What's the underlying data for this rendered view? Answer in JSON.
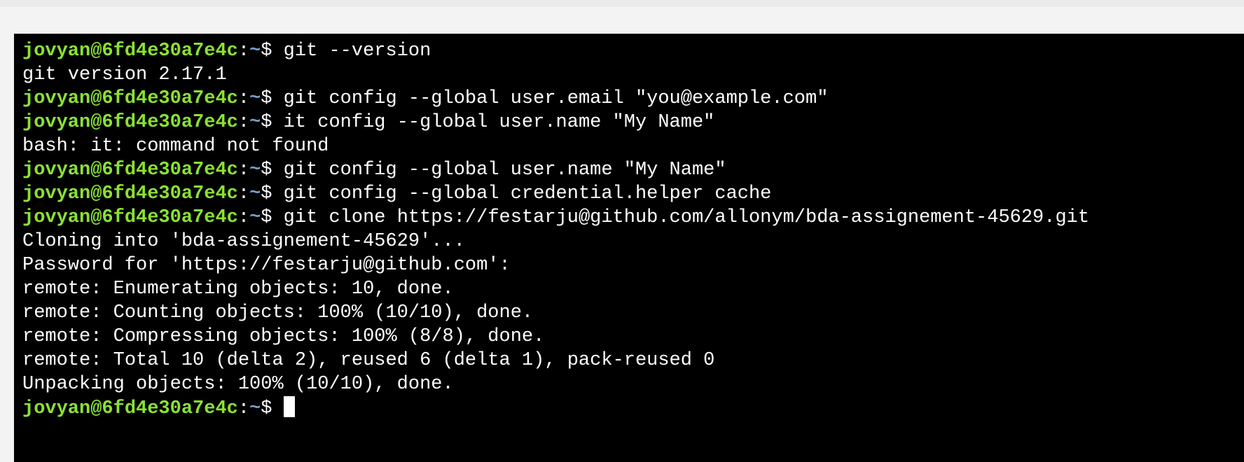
{
  "terminal": {
    "prompt_user_host": "jovyan@6fd4e30a7e4c",
    "prompt_path": "~",
    "prompt_symbol": "$ ",
    "colors": {
      "background": "#000000",
      "prompt_host": "#8ae234",
      "prompt_path": "#729fcf",
      "text": "#ffffff"
    },
    "lines": [
      {
        "type": "command",
        "text": "git --version"
      },
      {
        "type": "output",
        "text": "git version 2.17.1"
      },
      {
        "type": "command",
        "text": "git config --global user.email \"you@example.com\""
      },
      {
        "type": "command",
        "text": "it config --global user.name \"My Name\""
      },
      {
        "type": "output",
        "text": "bash: it: command not found"
      },
      {
        "type": "command",
        "text": "git config --global user.name \"My Name\""
      },
      {
        "type": "command",
        "text": "git config --global credential.helper cache"
      },
      {
        "type": "command",
        "text": "git clone https://festarju@github.com/allonym/bda-assignement-45629.git"
      },
      {
        "type": "output",
        "text": "Cloning into 'bda-assignement-45629'..."
      },
      {
        "type": "output",
        "text": "Password for 'https://festarju@github.com':"
      },
      {
        "type": "output",
        "text": "remote: Enumerating objects: 10, done."
      },
      {
        "type": "output",
        "text": "remote: Counting objects: 100% (10/10), done."
      },
      {
        "type": "output",
        "text": "remote: Compressing objects: 100% (8/8), done."
      },
      {
        "type": "output",
        "text": "remote: Total 10 (delta 2), reused 6 (delta 1), pack-reused 0"
      },
      {
        "type": "output",
        "text": "Unpacking objects: 100% (10/10), done."
      },
      {
        "type": "input",
        "text": ""
      }
    ]
  }
}
